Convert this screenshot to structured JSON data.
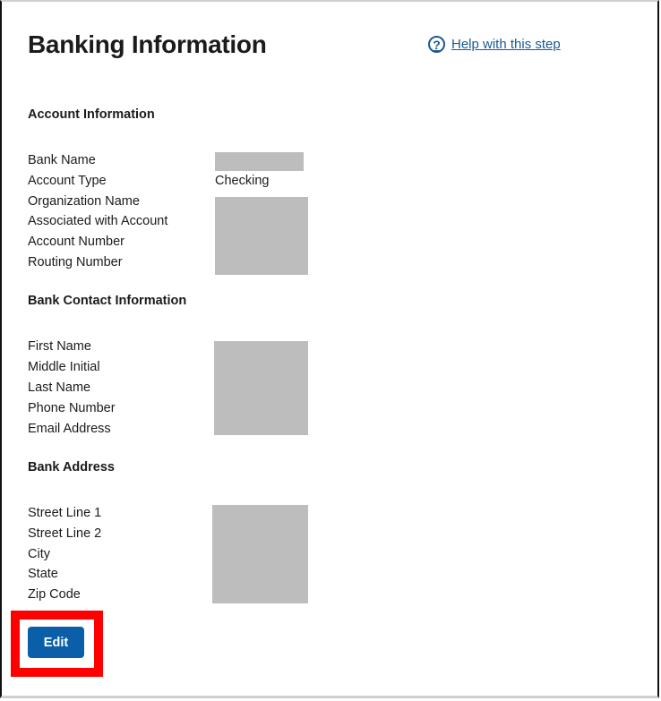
{
  "page": {
    "title": "Banking Information",
    "help_link": "Help with this step",
    "help_icon": "question-circle-icon"
  },
  "sections": {
    "account": {
      "title": "Account Information",
      "fields": [
        {
          "label": "Bank Name",
          "value": ""
        },
        {
          "label": "Account Type",
          "value": "Checking"
        },
        {
          "label": "Organization Name",
          "value": ""
        },
        {
          "label": "Associated with Account",
          "value": ""
        },
        {
          "label": "Account Number",
          "value": ""
        },
        {
          "label": "Routing Number",
          "value": ""
        }
      ]
    },
    "contact": {
      "title": "Bank Contact Information",
      "fields": [
        {
          "label": "First Name",
          "value": ""
        },
        {
          "label": "Middle Initial",
          "value": ""
        },
        {
          "label": "Last Name",
          "value": ""
        },
        {
          "label": "Phone Number",
          "value": ""
        },
        {
          "label": "Email Address",
          "value": ""
        }
      ]
    },
    "address": {
      "title": "Bank Address",
      "fields": [
        {
          "label": "Street Line 1",
          "value": ""
        },
        {
          "label": "Street Line 2",
          "value": ""
        },
        {
          "label": "City",
          "value": ""
        },
        {
          "label": "State",
          "value": ""
        },
        {
          "label": "Zip Code",
          "value": ""
        }
      ]
    }
  },
  "actions": {
    "edit_label": "Edit"
  },
  "colors": {
    "accent": "#0b5ea8",
    "link": "#1a5a96",
    "highlight": "#ff0000",
    "redaction": "#bdbdbd"
  }
}
